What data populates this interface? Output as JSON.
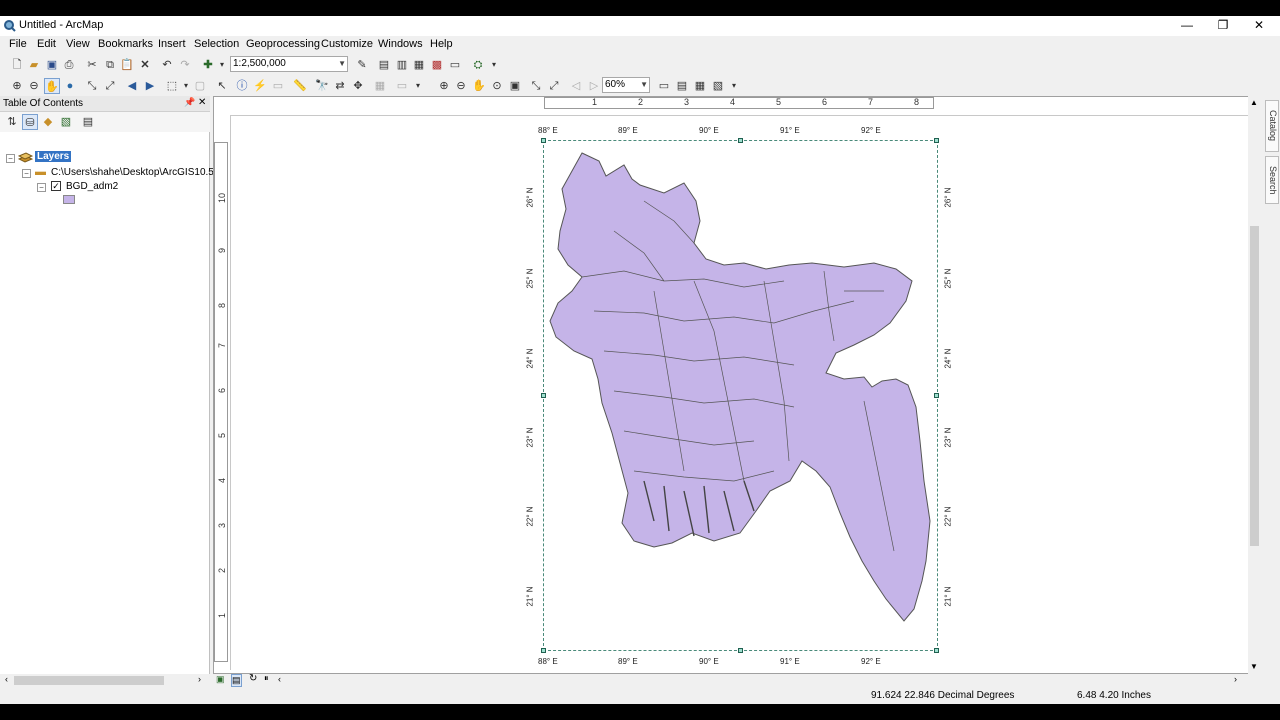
{
  "window": {
    "title": "Untitled - ArcMap",
    "minimize": "—",
    "maximize": "❐",
    "close": "✕"
  },
  "menu": [
    "File",
    "Edit",
    "View",
    "Bookmarks",
    "Insert",
    "Selection",
    "Geoprocessing",
    "Customize",
    "Windows",
    "Help"
  ],
  "toolbar": {
    "scale_value": "1:2,500,000",
    "zoom_value": "60%"
  },
  "toc": {
    "title": "Table Of Contents",
    "pin": "📌",
    "close": "✕",
    "layers_label": "Layers",
    "folder_path": "C:\\Users\\shahe\\Desktop\\ArcGIS10.5\\",
    "layer_name": "BGD_adm2",
    "layer_checked": true,
    "symbol_color": "#c5b4e8"
  },
  "ruler_h": [
    "1",
    "2",
    "3",
    "4",
    "5",
    "6",
    "7",
    "8"
  ],
  "ruler_v": [
    "10",
    "9",
    "8",
    "7",
    "6",
    "5",
    "4",
    "3",
    "2",
    "1"
  ],
  "map": {
    "lon_labels": [
      "88° E",
      "89° E",
      "90° E",
      "91° E",
      "92° E"
    ],
    "lat_labels": [
      "26° N",
      "25° N",
      "24° N",
      "23° N",
      "22° N",
      "21° N"
    ],
    "fill_color": "#c5b4e8",
    "stroke_color": "#555555"
  },
  "dock": {
    "catalog": "Catalog",
    "search": "Search"
  },
  "status": {
    "coords": "91.624  22.846 Decimal Degrees",
    "page_size": "6.48  4.20 Inches"
  }
}
